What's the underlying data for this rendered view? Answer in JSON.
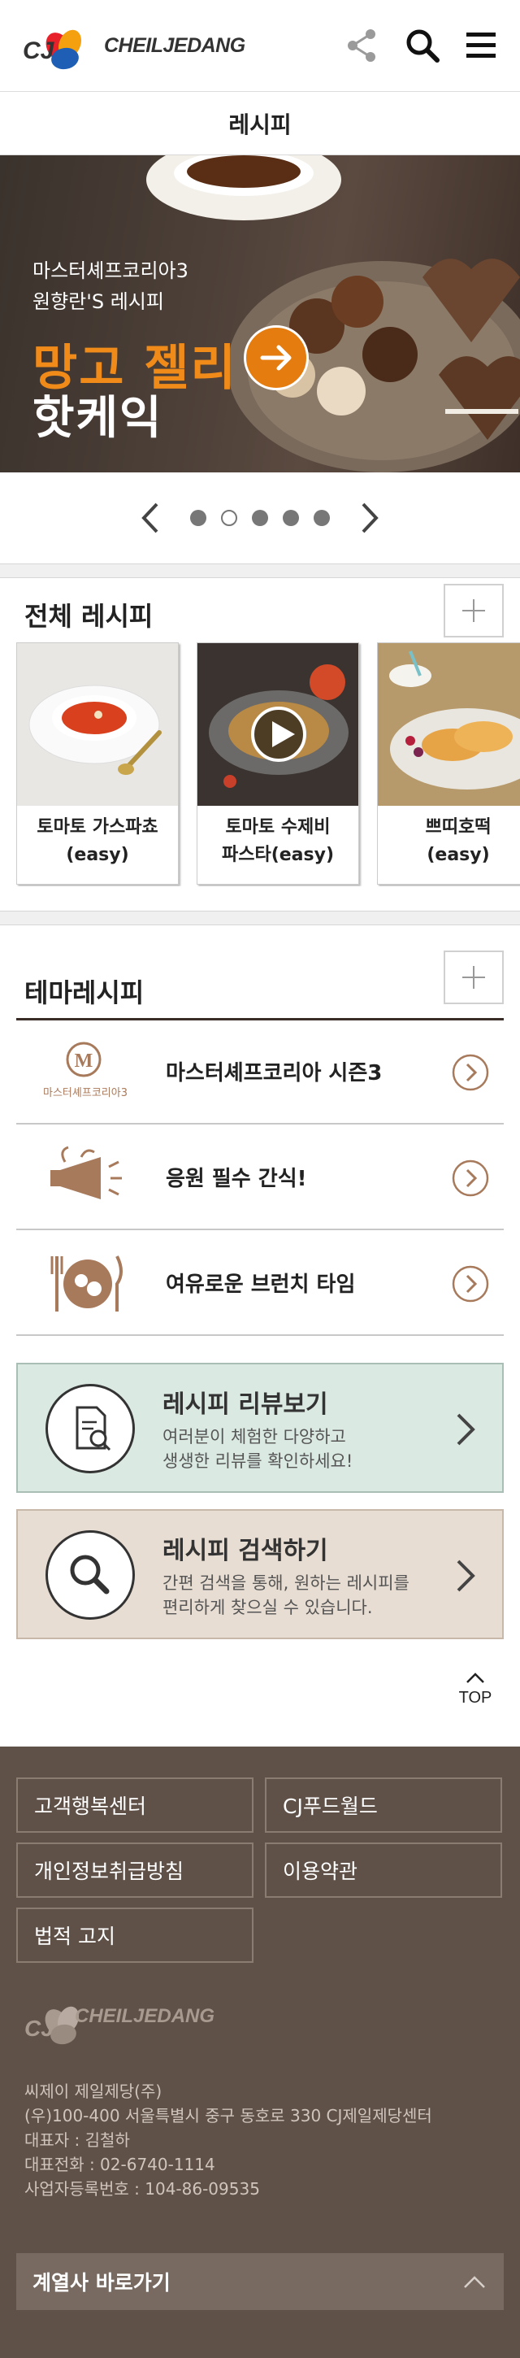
{
  "header": {
    "logo_text": "CHEILJEDANG",
    "share_icon": "share-icon",
    "search_icon": "search-icon",
    "menu_icon": "hamburger-menu-icon"
  },
  "page_title": "레시피",
  "banner": {
    "subtitle_1": "마스터셰프코리아3",
    "subtitle_2": "원향란'S 레시피",
    "headline_1": "망고 젤리",
    "headline_2": "핫케익"
  },
  "slider": {
    "dots": [
      true,
      false,
      true,
      true,
      true
    ],
    "active_index": 1
  },
  "all_recipes": {
    "title": "전체 레시피",
    "cards": [
      {
        "line1": "토마토 가스파쵸",
        "line2": "(easy)"
      },
      {
        "line1": "토마토 수제비",
        "line2": "파스타(easy)"
      },
      {
        "line1": "쁘띠호떡",
        "line2": "(easy)"
      }
    ]
  },
  "theme_recipes": {
    "title": "테마레시피",
    "items": [
      {
        "label": "마스터셰프코리아 시즌3",
        "icon_caption": "마스터셰프코리아3",
        "icon": "masterchef-logo-icon"
      },
      {
        "label": "응원 필수 간식!",
        "icon": "megaphone-icon"
      },
      {
        "label": "여유로운 브런치 타임",
        "icon": "brunch-plate-icon"
      }
    ]
  },
  "promo": {
    "review": {
      "title": "레시피 리뷰보기",
      "desc_1": "여러분이 체험한 다양하고",
      "desc_2": "생생한 리뷰를 확인하세요!",
      "bg": "#dbe9e3"
    },
    "search": {
      "title": "레시피 검색하기",
      "desc_1": "간편 검색을 통해, 원하는 레시피를",
      "desc_2": "편리하게 찾으실 수 있습니다.",
      "bg": "#e8ddd2"
    }
  },
  "top_button": "TOP",
  "footer": {
    "links": [
      "고객행복센터",
      "CJ푸드월드",
      "개인정보취급방침",
      "이용약관",
      "법적 고지"
    ],
    "logo_text": "CHEILJEDANG",
    "company": "씨제이 제일제당(주)",
    "address": "(우)100-400 서울특별시 중구 동호로 330 CJ제일제당센터",
    "ceo": "대표자 : 김철하",
    "phone": "대표전화 : 02-6740-1114",
    "biz_no": "사업자등록번호 : 104-86-09535",
    "family_sites": "계열사 바로가기"
  },
  "colors": {
    "accent_orange": "#e57c10",
    "footer_bg": "#5f5148",
    "theme_brown": "#a87a5c"
  }
}
